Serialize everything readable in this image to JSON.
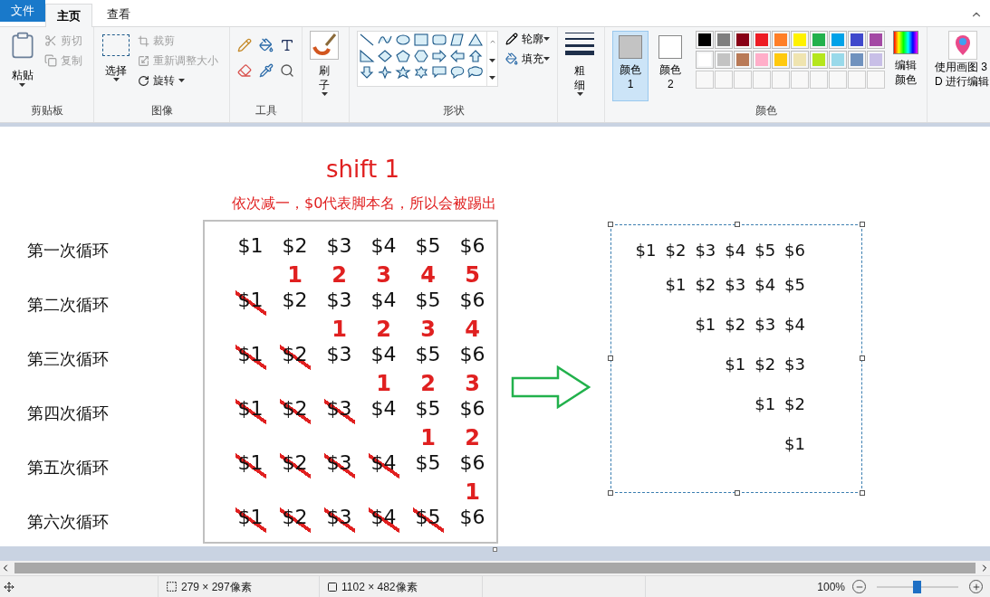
{
  "menu_tabs": [
    {
      "label": "文件",
      "kind": "file",
      "selected": false
    },
    {
      "label": "主页",
      "kind": "tab",
      "selected": true
    },
    {
      "label": "查看",
      "kind": "tab",
      "selected": false
    }
  ],
  "ribbon": {
    "clipboard": {
      "paste": "粘贴",
      "cut": {
        "label": "剪切",
        "disabled": true
      },
      "copy": {
        "label": "复制",
        "disabled": true
      },
      "label": "剪贴板"
    },
    "image": {
      "select": "选择",
      "crop": {
        "label": "裁剪",
        "disabled": true
      },
      "resize": {
        "label": "重新调整大小",
        "disabled": true
      },
      "rotate": {
        "label": "旋转",
        "disabled": false
      },
      "label": "图像"
    },
    "tools": {
      "label": "工具"
    },
    "brushes": {
      "label": "刷子"
    },
    "shapes": {
      "outline": "轮廓",
      "fill": "填充",
      "label": "形状"
    },
    "size": {
      "label": "粗细"
    },
    "colors": {
      "slots": [
        {
          "label": "颜色 1",
          "color": "#c3c3c3",
          "selected": true
        },
        {
          "label": "颜色 2",
          "color": "#ffffff",
          "selected": false
        }
      ],
      "palette": [
        {
          "color": "#000000"
        },
        {
          "color": "#7f7f7f"
        },
        {
          "color": "#880015"
        },
        {
          "color": "#ed1c24"
        },
        {
          "color": "#ff7f27"
        },
        {
          "color": "#fff200"
        },
        {
          "color": "#22b14c"
        },
        {
          "color": "#00a2e8"
        },
        {
          "color": "#3f48cc"
        },
        {
          "color": "#a349a4"
        },
        {
          "color": "#ffffff"
        },
        {
          "color": "#c3c3c3"
        },
        {
          "color": "#b97a57"
        },
        {
          "color": "#ffaec9"
        },
        {
          "color": "#ffc90e"
        },
        {
          "color": "#efe4b0"
        },
        {
          "color": "#b5e61d"
        },
        {
          "color": "#99d9ea"
        },
        {
          "color": "#7092be"
        },
        {
          "color": "#c8bfe7"
        }
      ],
      "edit": "编辑颜色",
      "label": "颜色"
    },
    "paint3d": [
      "使用画图 3",
      "D 进行编辑"
    ]
  },
  "canvas": {
    "title": "shift 1",
    "note": "依次减一，$0代表脚本名，所以会被踢出",
    "rows": [
      {
        "label": "第一次循环",
        "cells": [
          {
            "text": "$1",
            "struck": false
          },
          {
            "text": "$2",
            "struck": false
          },
          {
            "text": "$3",
            "struck": false
          },
          {
            "text": "$4",
            "struck": false
          },
          {
            "text": "$5",
            "struck": false
          },
          {
            "text": "$6",
            "struck": false
          }
        ]
      },
      {
        "label": "第二次循环",
        "cells": [
          {
            "text": "$1",
            "struck": true
          },
          {
            "text": "$2",
            "struck": false,
            "index": "1"
          },
          {
            "text": "$3",
            "struck": false,
            "index": "2"
          },
          {
            "text": "$4",
            "struck": false,
            "index": "3"
          },
          {
            "text": "$5",
            "struck": false,
            "index": "4"
          },
          {
            "text": "$6",
            "struck": false,
            "index": "5"
          }
        ]
      },
      {
        "label": "第三次循环",
        "cells": [
          {
            "text": "$1",
            "struck": true
          },
          {
            "text": "$2",
            "struck": true
          },
          {
            "text": "$3",
            "struck": false,
            "index": "1"
          },
          {
            "text": "$4",
            "struck": false,
            "index": "2"
          },
          {
            "text": "$5",
            "struck": false,
            "index": "3"
          },
          {
            "text": "$6",
            "struck": false,
            "index": "4"
          }
        ]
      },
      {
        "label": "第四次循环",
        "cells": [
          {
            "text": "$1",
            "struck": true
          },
          {
            "text": "$2",
            "struck": true
          },
          {
            "text": "$3",
            "struck": true
          },
          {
            "text": "$4",
            "struck": false,
            "index": "1"
          },
          {
            "text": "$5",
            "struck": false,
            "index": "2"
          },
          {
            "text": "$6",
            "struck": false,
            "index": "3"
          }
        ]
      },
      {
        "label": "第五次循环",
        "cells": [
          {
            "text": "$1",
            "struck": true
          },
          {
            "text": "$2",
            "struck": true
          },
          {
            "text": "$3",
            "struck": true
          },
          {
            "text": "$4",
            "struck": true
          },
          {
            "text": "$5",
            "struck": false,
            "index": "1"
          },
          {
            "text": "$6",
            "struck": false,
            "index": "2"
          }
        ]
      },
      {
        "label": "第六次循环",
        "cells": [
          {
            "text": "$1",
            "struck": true
          },
          {
            "text": "$2",
            "struck": true
          },
          {
            "text": "$3",
            "struck": true
          },
          {
            "text": "$4",
            "struck": true
          },
          {
            "text": "$5",
            "struck": true
          },
          {
            "text": "$6",
            "struck": false,
            "index": "1"
          }
        ]
      }
    ],
    "result": [
      [
        "$1",
        "$2",
        "$3",
        "$4",
        "$5",
        "$6"
      ],
      [
        "$1",
        "$2",
        "$3",
        "$4",
        "$5"
      ],
      [
        "$1",
        "$2",
        "$3",
        "$4"
      ],
      [
        "$1",
        "$2",
        "$3"
      ],
      [
        "$1",
        "$2"
      ],
      [
        "$1"
      ]
    ]
  },
  "status_bar": {
    "selection_size": "279 × 297像素",
    "image_size": "1102 × 482像素",
    "zoom": "100%",
    "zoom_slider": {
      "level": 0.49
    }
  }
}
